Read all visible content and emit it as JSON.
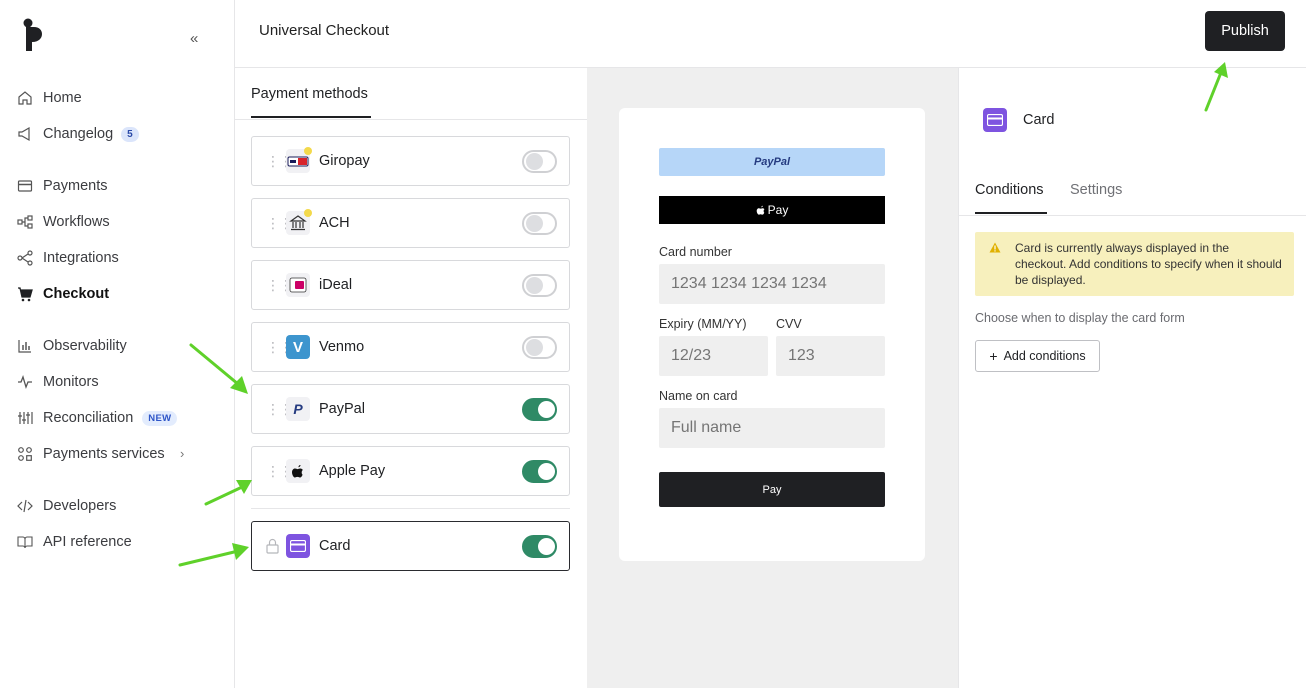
{
  "sidebar": {
    "collapse_icon": "«",
    "items": [
      {
        "label": "Home",
        "icon": "home-icon"
      },
      {
        "label": "Changelog",
        "icon": "megaphone-icon",
        "badge": "5"
      },
      {
        "label": "Payments",
        "icon": "credit-card-icon"
      },
      {
        "label": "Workflows",
        "icon": "workflow-icon"
      },
      {
        "label": "Integrations",
        "icon": "integrations-icon"
      },
      {
        "label": "Checkout",
        "icon": "cart-icon",
        "active": true
      },
      {
        "label": "Observability",
        "icon": "bar-chart-icon"
      },
      {
        "label": "Monitors",
        "icon": "pulse-icon"
      },
      {
        "label": "Reconciliation",
        "icon": "reconciliation-icon",
        "badge": "NEW"
      },
      {
        "label": "Payments services",
        "icon": "services-icon",
        "chevron": "›"
      },
      {
        "label": "Developers",
        "icon": "code-icon"
      },
      {
        "label": "API reference",
        "icon": "book-icon"
      }
    ]
  },
  "header": {
    "title": "Universal Checkout",
    "publish_label": "Publish"
  },
  "methods": {
    "tab_label": "Payment methods",
    "items": [
      {
        "name": "Giropay",
        "enabled": false
      },
      {
        "name": "ACH",
        "enabled": false
      },
      {
        "name": "iDeal",
        "enabled": false
      },
      {
        "name": "Venmo",
        "enabled": false
      },
      {
        "name": "PayPal",
        "enabled": true
      },
      {
        "name": "Apple Pay",
        "enabled": true
      },
      {
        "name": "Card",
        "enabled": true,
        "locked": true
      }
    ]
  },
  "preview": {
    "paypal_label": "PayPal",
    "applepay_label": "Pay",
    "card_number_label": "Card number",
    "card_number_placeholder": "1234 1234 1234 1234",
    "expiry_label": "Expiry (MM/YY)",
    "expiry_placeholder": "12/23",
    "cvv_label": "CVV",
    "cvv_placeholder": "123",
    "name_label": "Name on card",
    "name_placeholder": "Full name",
    "pay_label": "Pay"
  },
  "details": {
    "title": "Card",
    "tabs": [
      "Conditions",
      "Settings"
    ],
    "warning": "Card is currently always displayed in the checkout. Add conditions to specify when it should be displayed.",
    "hint": "Choose when to display the card form",
    "add_conditions_label": "Add conditions"
  },
  "colors": {
    "accent_dark": "#1f2023",
    "toggle_on": "#2f8a66",
    "warning_bg": "#f7f0bd",
    "card_purple": "#7e54e0",
    "annotation_arrow": "#5fd12a"
  }
}
